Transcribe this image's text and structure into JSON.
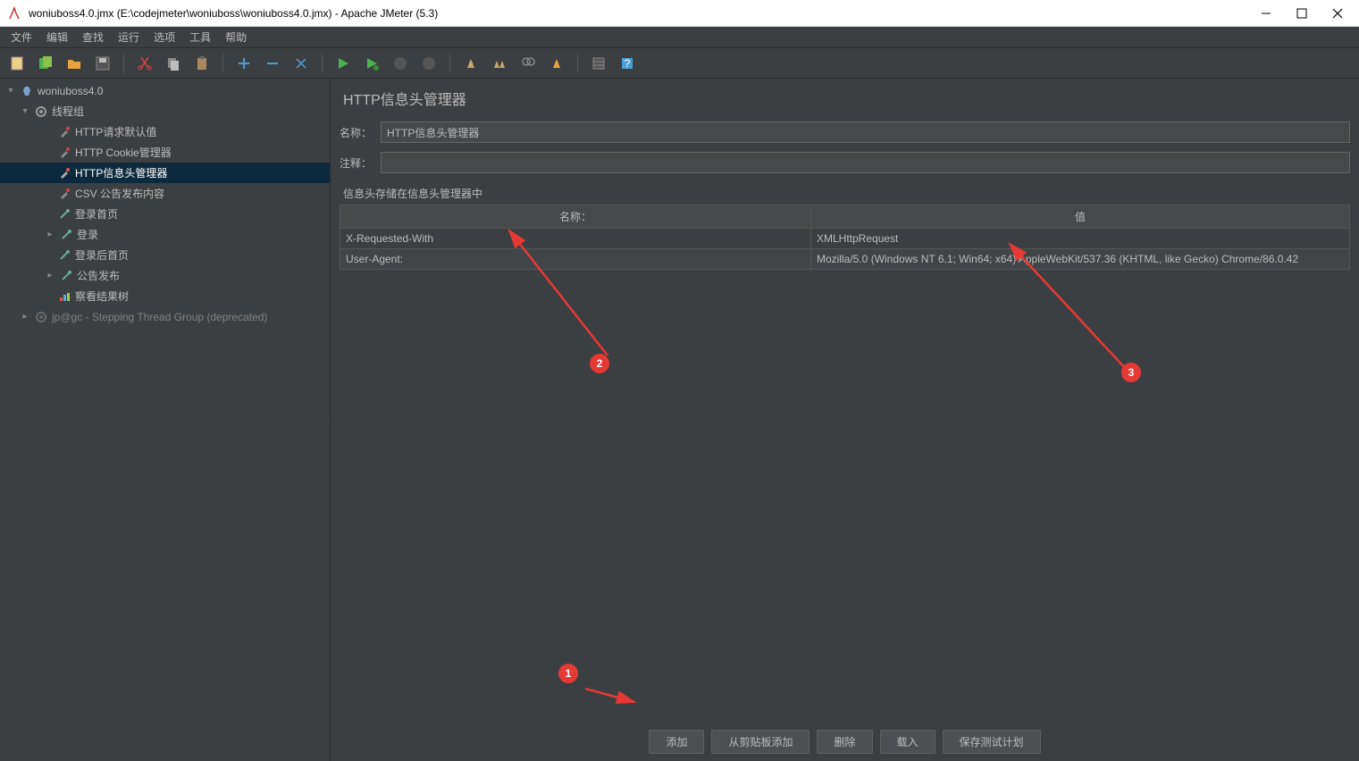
{
  "window": {
    "title": "woniuboss4.0.jmx (E:\\codejmeter\\woniuboss\\woniuboss4.0.jmx) - Apache JMeter (5.3)"
  },
  "menu": {
    "file": "文件",
    "edit": "编辑",
    "search": "查找",
    "run": "运行",
    "options": "选项",
    "tools": "工具",
    "help": "帮助"
  },
  "tree": {
    "root": "woniuboss4.0",
    "group": "线程组",
    "items": [
      "HTTP请求默认值",
      "HTTP Cookie管理器",
      "HTTP信息头管理器",
      "CSV 公告发布内容",
      "登录首页",
      "登录",
      "登录后首页",
      "公告发布",
      "察看结果树"
    ],
    "deprecated": "jp@gc - Stepping Thread Group (deprecated)"
  },
  "editor": {
    "title": "HTTP信息头管理器",
    "name_label": "名称：",
    "name_value": "HTTP信息头管理器",
    "comment_label": "注释：",
    "comment_value": "",
    "section_label": "信息头存储在信息头管理器中",
    "table": {
      "col_name": "名称：",
      "col_value": "值",
      "rows": [
        {
          "name": "X-Requested-With",
          "value": "XMLHttpRequest"
        },
        {
          "name": "User-Agent:",
          "value": "Mozilla/5.0 (Windows NT 6.1; Win64; x64) AppleWebKit/537.36 (KHTML, like Gecko) Chrome/86.0.42"
        }
      ]
    },
    "buttons": {
      "add": "添加",
      "add_clipboard": "从剪贴板添加",
      "delete": "删除",
      "load": "载入",
      "save": "保存测试计划"
    }
  },
  "annotations": {
    "b1": "1",
    "b2": "2",
    "b3": "3"
  }
}
